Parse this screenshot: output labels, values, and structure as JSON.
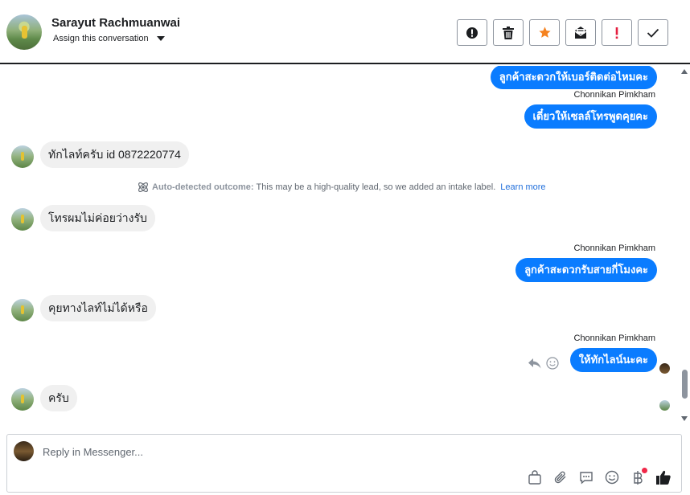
{
  "header": {
    "contact_name": "Sarayut Rachmuanwai",
    "assign_label": "Assign this conversation",
    "actions": [
      {
        "icon": "alert-circle-icon"
      },
      {
        "icon": "trash-icon"
      },
      {
        "icon": "star-icon"
      },
      {
        "icon": "mark-unread-icon"
      },
      {
        "icon": "exclamation-icon"
      },
      {
        "icon": "checkmark-icon"
      }
    ]
  },
  "messages": {
    "m1": {
      "text": "ลูกค้าสะดวกให้เบอร์ติดต่อไหมคะ"
    },
    "s2": "Chonnikan Pimkham",
    "m2": {
      "text": "เดี๋ยวให้เซลล์โทรพูดคุยคะ"
    },
    "m3": {
      "text": "ทักไลท์ครับ id 0872220774"
    },
    "auto": {
      "label": "Auto-detected outcome:",
      "text": "This may be a high-quality lead, so we added an intake label.",
      "link": "Learn more"
    },
    "m4": {
      "text": "โทรผมไม่ค่อยว่างรับ"
    },
    "s5": "Chonnikan Pimkham",
    "m5": {
      "text": "ลูกค้าสะดวกรับสายกี่โมงคะ"
    },
    "m6": {
      "text": "คุยทางไลท์ไม่ได้หรือ"
    },
    "s7": "Chonnikan Pimkham",
    "m7": {
      "text": "ให้ทักไลน์นะคะ"
    },
    "m8": {
      "text": "ครับ"
    }
  },
  "composer": {
    "placeholder": "Reply in Messenger...",
    "tools": [
      "bag-icon",
      "paperclip-icon",
      "chat-bubble-icon",
      "emoji-icon",
      "baht-icon",
      "thumbs-up-icon"
    ]
  },
  "colors": {
    "outgoing_bubble": "#0a7cff",
    "incoming_bubble": "#f0f0f0",
    "star": "#f5821f",
    "exclamation": "#e41e3f",
    "link": "#216fdb"
  }
}
